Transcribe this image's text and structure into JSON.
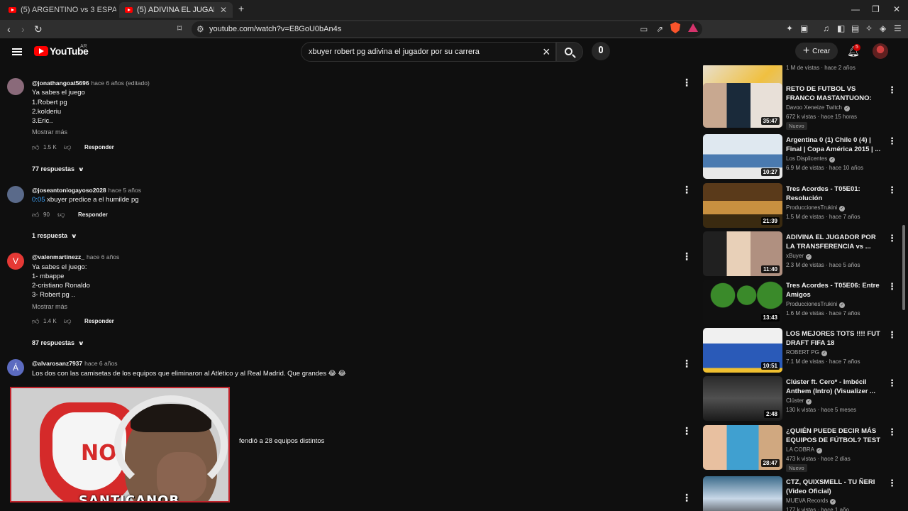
{
  "browser": {
    "tabs": [
      {
        "title": "(5) ARGENTINO vs 3 ESPAÑOLES *¿Qu",
        "active": false
      },
      {
        "title": "(5) ADIVINA EL JUGADOR POR LA",
        "active": true
      }
    ],
    "new_tab_symbol": "+",
    "url": "youtube.com/watch?v=E8GoU0bAn4s"
  },
  "youtube": {
    "logo_text": "YouTube",
    "country_code": "AR",
    "search_query": "xbuyer robert pg adivina el jugador por su carrera",
    "create_label": "Crear",
    "notifications_count": "5"
  },
  "comments": [
    {
      "author": "@jonathangoat5696",
      "time": "hace 6 años (editado)",
      "avatar_color": "#8a6a7a",
      "avatar_letter": "",
      "lines": [
        "Ya sabes el juego",
        "1.Robert pg",
        "2.kolderiu",
        "3.Eric.."
      ],
      "more": "Mostrar más",
      "likes": "1.5 K",
      "reply": "Responder",
      "replies": "77 respuestas"
    },
    {
      "author": "@joseantoniogayoso2028",
      "time": "hace 5 años",
      "avatar_color": "#5a6a8a",
      "avatar_letter": "",
      "timestamp": "0:05",
      "lines": [
        "xbuyer predice a el humilde pg"
      ],
      "likes": "90",
      "reply": "Responder",
      "replies": "1 respuesta"
    },
    {
      "author": "@valenmartinezz_",
      "time": "hace 6 años",
      "avatar_color": "#e53935",
      "avatar_letter": "V",
      "lines": [
        "Ya sabes el juego:",
        "1- mbappe",
        "2-cristiano Ronaldo",
        "3- Robert pg .."
      ],
      "more": "Mostrar más",
      "likes": "1.4 K",
      "reply": "Responder",
      "replies": "87 respuestas"
    },
    {
      "author": "@alvarosanz7937",
      "time": "hace 6 años",
      "avatar_color": "#5c6bc0",
      "avatar_letter": "Á",
      "lines": [
        "Los dos con las camisetas de los equipos que eliminaron al Atlético y al Real Madrid. Que grandes 😂 😂"
      ]
    }
  ],
  "partial_comment_text": "fendió a 28 equipos distintos",
  "facecam": {
    "flag_text": "NO",
    "streamer_name": "SANTICANOB"
  },
  "related_videos": [
    {
      "title": "",
      "channel": "",
      "meta": "1 M de vistas · hace 2 años",
      "duration": "17:53",
      "verified": false,
      "new": false,
      "thumb": "linear-gradient(135deg,#e8e0d0,#f0c040 60%,#d8c8a0)"
    },
    {
      "title": "RETO DE FUTBOL VS FRANCO MASTANTUONO: UNA IMAGE...",
      "channel": "Davoo Xeneize Twitch",
      "meta": "672 k vistas · hace 15 horas",
      "duration": "35:47",
      "verified": true,
      "new": true,
      "new_label": "Nuevo",
      "thumb": "linear-gradient(90deg,#c8a890 0 30%,#1a2a3a 30% 60%,#e8e0d8 60%)"
    },
    {
      "title": "Argentina 0 (1) Chile 0 (4) | Final | Copa América 2015 | ...",
      "channel": "Los Displicentes",
      "meta": "6.9 M de vistas · hace 10 años",
      "duration": "10:27",
      "verified": true,
      "new": false,
      "thumb": "linear-gradient(180deg,#dfe8f0 0 45%,#4a7ab0 45% 75%,#e8e8e8 75%)"
    },
    {
      "title": "Tres Acordes - T05E01: Resolución",
      "channel": "ProduccionesTrukini",
      "meta": "1.5 M de vistas · hace 7 años",
      "duration": "21:39",
      "verified": true,
      "new": false,
      "thumb": "linear-gradient(180deg,#5a3a1a 0 40%,#c89040 40% 70%,#3a2a10 70%)"
    },
    {
      "title": "ADIVINA EL JUGADOR POR LA TRANSFERENCIA vs ...",
      "channel": "xBuyer",
      "meta": "2.3 M de vistas · hace 5 años",
      "duration": "11:40",
      "verified": true,
      "new": false,
      "thumb": "linear-gradient(90deg,#202020 0 30%,#e8d0b8 30% 60%,#b09080 60%)"
    },
    {
      "title": "Tres Acordes - T05E06: Entre Amigos",
      "channel": "ProduccionesTrukini",
      "meta": "1.6 M de vistas · hace 7 años",
      "duration": "13:43",
      "verified": true,
      "new": false,
      "thumb": "radial-gradient(circle at 25% 35%,#3a8a2a 0 18%,transparent 19%),radial-gradient(circle at 55% 35%,#3a8a2a 0 18%,transparent 19%),radial-gradient(circle at 85% 35%,#3a8a2a 0 18%,transparent 19%),#101010"
    },
    {
      "title": "LOS MEJORES TOTS !!!! FUT DRAFT FIFA 18",
      "channel": "ROBERT PG",
      "meta": "7.1 M de vistas · hace 7 años",
      "duration": "10:51",
      "verified": true,
      "new": false,
      "thumb": "linear-gradient(180deg,#f0f0f0 0 35%,#2a5ab8 35% 90%,#f0c030 90%)"
    },
    {
      "title": "Clúster ft. Cero* - Imbécil Anthem (Intro) (Visualizer ...",
      "channel": "Clúster",
      "meta": "130 k vistas · hace 5 meses",
      "duration": "2:48",
      "verified": true,
      "new": false,
      "thumb": "linear-gradient(180deg,#2a2a2a,#505050 50%,#1a1a1a)"
    },
    {
      "title": "¿QUIÉN PUEDE DECIR MÁS EQUIPOS DE FÚTBOL? TEST ...",
      "channel": "LA COBRA",
      "meta": "473 k vistas · hace 2 días",
      "duration": "28:47",
      "verified": true,
      "new": true,
      "new_label": "Nuevo",
      "thumb": "linear-gradient(90deg,#e8c0a0 0 30%,#40a0d0 30% 70%,#d0a880 70%)"
    },
    {
      "title": "CTZ, QUIXSMELL - TU ÑERI (Video Oficial)",
      "channel": "MUEVA Records",
      "meta": "177 k vistas · hace 1 año",
      "duration": "",
      "verified": true,
      "new": false,
      "thumb": "linear-gradient(180deg,#3a6a8a,#c8d8e8 50%,#2a2a2a)"
    }
  ]
}
